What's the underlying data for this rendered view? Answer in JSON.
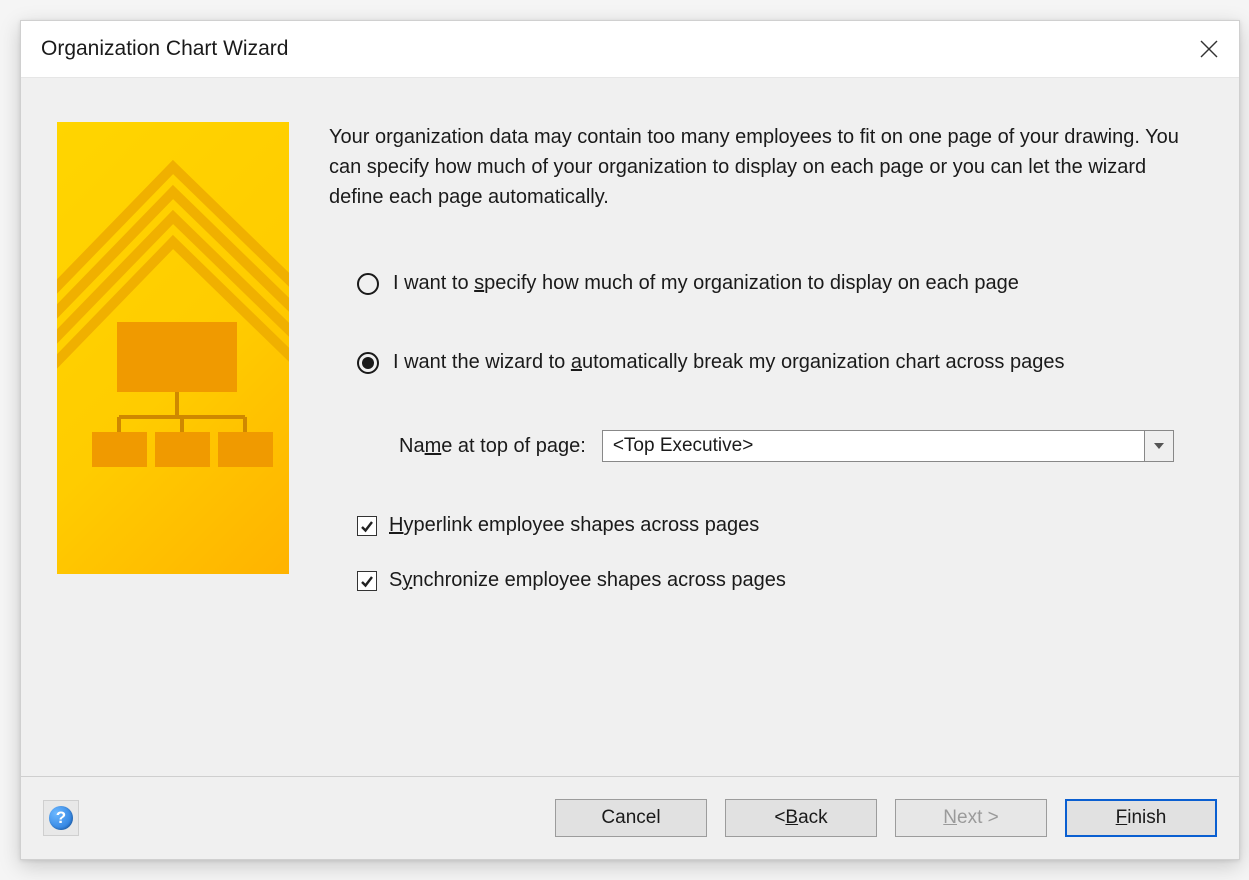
{
  "title": "Organization Chart Wizard",
  "intro": "Your organization data may contain too many employees to fit on one page of your drawing. You can specify how much of your organization to display on each page or you can let the wizard define each page automatically.",
  "options": {
    "specify": {
      "pre": "I want to ",
      "u": "s",
      "post": "pecify how much of my organization to display on each page",
      "selected": false
    },
    "auto": {
      "pre": "I want the wizard to ",
      "u": "a",
      "post": "utomatically break my organization chart across pages",
      "selected": true
    }
  },
  "nameField": {
    "label_pre": "Na",
    "label_u": "m",
    "label_post": "e at top of page:",
    "value": "<Top Executive>"
  },
  "checks": {
    "hyperlink": {
      "u": "H",
      "post": "yperlink employee shapes across pages",
      "checked": true
    },
    "sync": {
      "pre": "S",
      "u": "y",
      "post": "nchronize employee shapes across pages",
      "checked": true
    }
  },
  "buttons": {
    "cancel": "Cancel",
    "back_pre": "< ",
    "back_u": "B",
    "back_post": "ack",
    "next_u": "N",
    "next_post": "ext >",
    "finish_u": "F",
    "finish_post": "inish"
  },
  "help": "?"
}
